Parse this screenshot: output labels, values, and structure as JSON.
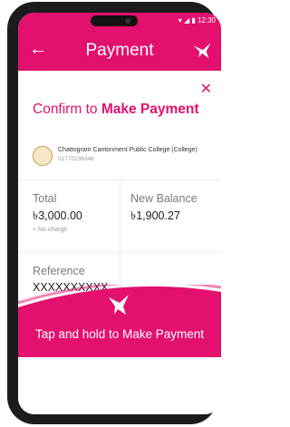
{
  "status": {
    "time": "12:30"
  },
  "appbar": {
    "title": "Payment"
  },
  "confirm": {
    "prefix": "Confirm to ",
    "bold": "Make Payment"
  },
  "merchant": {
    "name": "Chattogram Cantonment Public College (College)",
    "phone": "01770236346"
  },
  "summary": {
    "total_label": "Total",
    "total_value": "৳3,000.00",
    "charge_note": "+ No charge",
    "new_balance_label": "New Balance",
    "new_balance_value": "৳1,900.27",
    "reference_label": "Reference",
    "reference_value": "XXXXXXXXXX"
  },
  "action": {
    "label": "Tap and hold to Make Payment"
  },
  "colors": {
    "brand": "#e3106e"
  }
}
